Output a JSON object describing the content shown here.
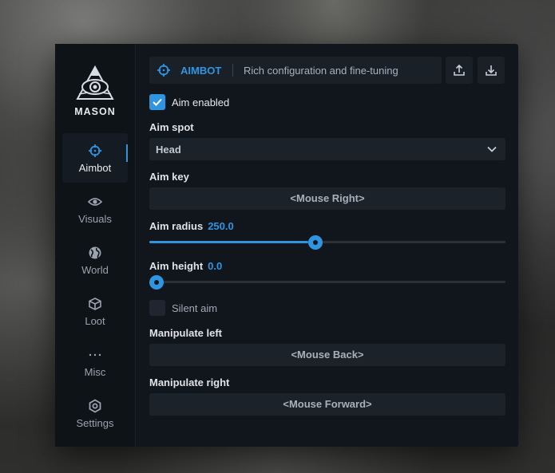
{
  "brand": {
    "name": "MASON"
  },
  "sidebar": {
    "items": [
      {
        "label": "Aimbot",
        "icon": "crosshair-icon",
        "active": true
      },
      {
        "label": "Visuals",
        "icon": "eye-icon",
        "active": false
      },
      {
        "label": "World",
        "icon": "globe-icon",
        "active": false
      },
      {
        "label": "Loot",
        "icon": "cube-icon",
        "active": false
      },
      {
        "label": "Misc",
        "icon": "ellipsis-icon",
        "active": false
      },
      {
        "label": "Settings",
        "icon": "gear-icon",
        "active": false
      }
    ]
  },
  "header": {
    "title": "AIMBOT",
    "subtitle": "Rich configuration and fine-tuning",
    "export_icon": "upload-icon",
    "import_icon": "download-icon"
  },
  "settings": {
    "aim_enabled": {
      "label": "Aim enabled",
      "checked": true
    },
    "aim_spot": {
      "label": "Aim spot",
      "value": "Head"
    },
    "aim_key": {
      "label": "Aim key",
      "value": "<Mouse Right>"
    },
    "aim_radius": {
      "label": "Aim radius",
      "value": "250.0",
      "fraction": 0.447
    },
    "aim_height": {
      "label": "Aim height",
      "value": "0.0",
      "fraction": 0.0
    },
    "silent_aim": {
      "label": "Silent aim",
      "checked": false
    },
    "manipulate_left": {
      "label": "Manipulate left",
      "value": "<Mouse Back>"
    },
    "manipulate_right": {
      "label": "Manipulate right",
      "value": "<Mouse Forward>"
    }
  },
  "colors": {
    "accent": "#2f95e0",
    "panel": "#11161d",
    "field": "#1b222a"
  }
}
